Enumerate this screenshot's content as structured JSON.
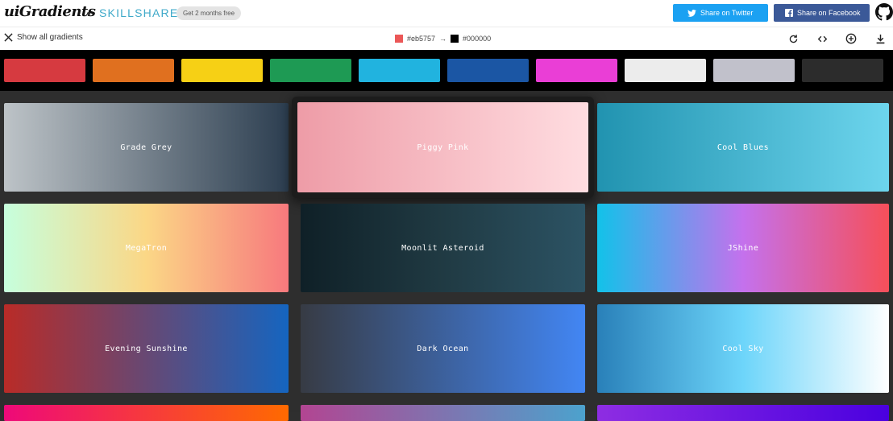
{
  "header": {
    "logo": "uiGradients",
    "partner": "SKILLSHARE",
    "promo": "Get 2 months free",
    "share_twitter": "Share on Twitter",
    "share_facebook": "Share on Facebook",
    "github_icon": "github-icon"
  },
  "toolbar": {
    "show_all": "Show all gradients",
    "color_from": "#eb5757",
    "color_from_label": "#eb5757",
    "arrow": "→",
    "color_to": "#000000",
    "color_to_label": "#000000",
    "icons": [
      "rotate-icon",
      "code-icon",
      "add-icon",
      "download-icon"
    ]
  },
  "filters": [
    {
      "name": "red",
      "color": "#d63a40"
    },
    {
      "name": "orange",
      "color": "#e0701f"
    },
    {
      "name": "yellow",
      "color": "#f6d015"
    },
    {
      "name": "green",
      "color": "#1e9a54"
    },
    {
      "name": "cyan",
      "color": "#21b3df"
    },
    {
      "name": "blue",
      "color": "#1b56a4"
    },
    {
      "name": "magenta",
      "color": "#ea3ed6"
    },
    {
      "name": "white",
      "color": "#ececec"
    },
    {
      "name": "grey",
      "color": "#c1c1cb"
    },
    {
      "name": "black",
      "color": "#2c2c2c"
    }
  ],
  "gradients": [
    {
      "name": "Grade Grey",
      "from": "#bdc3c7",
      "to": "#2c3e50"
    },
    {
      "name": "Piggy Pink",
      "from": "#ee9ca7",
      "to": "#ffdde1"
    },
    {
      "name": "Cool Blues",
      "from": "#2193b0",
      "to": "#6dd5ed"
    },
    {
      "name": "MegaTron",
      "from": "#c6ffdd",
      "via": "#fbd786",
      "to": "#f7797d"
    },
    {
      "name": "Moonlit Asteroid",
      "from": "#0f2027",
      "via": "#203a43",
      "to": "#2c5364"
    },
    {
      "name": "JShine",
      "from": "#12c2e9",
      "via": "#c471ed",
      "to": "#f64f59"
    },
    {
      "name": "Evening Sunshine",
      "from": "#b92b27",
      "to": "#1565c0"
    },
    {
      "name": "Dark Ocean",
      "from": "#373b44",
      "to": "#4286f4"
    },
    {
      "name": "Cool Sky",
      "from": "#2980b9",
      "via": "#6dd5fa",
      "to": "#ffffff"
    },
    {
      "name": "",
      "from": "#ee0979",
      "to": "#ff6a00"
    },
    {
      "name": "",
      "from": "#b24592",
      "to": "#4ca2cd"
    },
    {
      "name": "",
      "from": "#8e2de2",
      "to": "#4a00e0"
    }
  ]
}
